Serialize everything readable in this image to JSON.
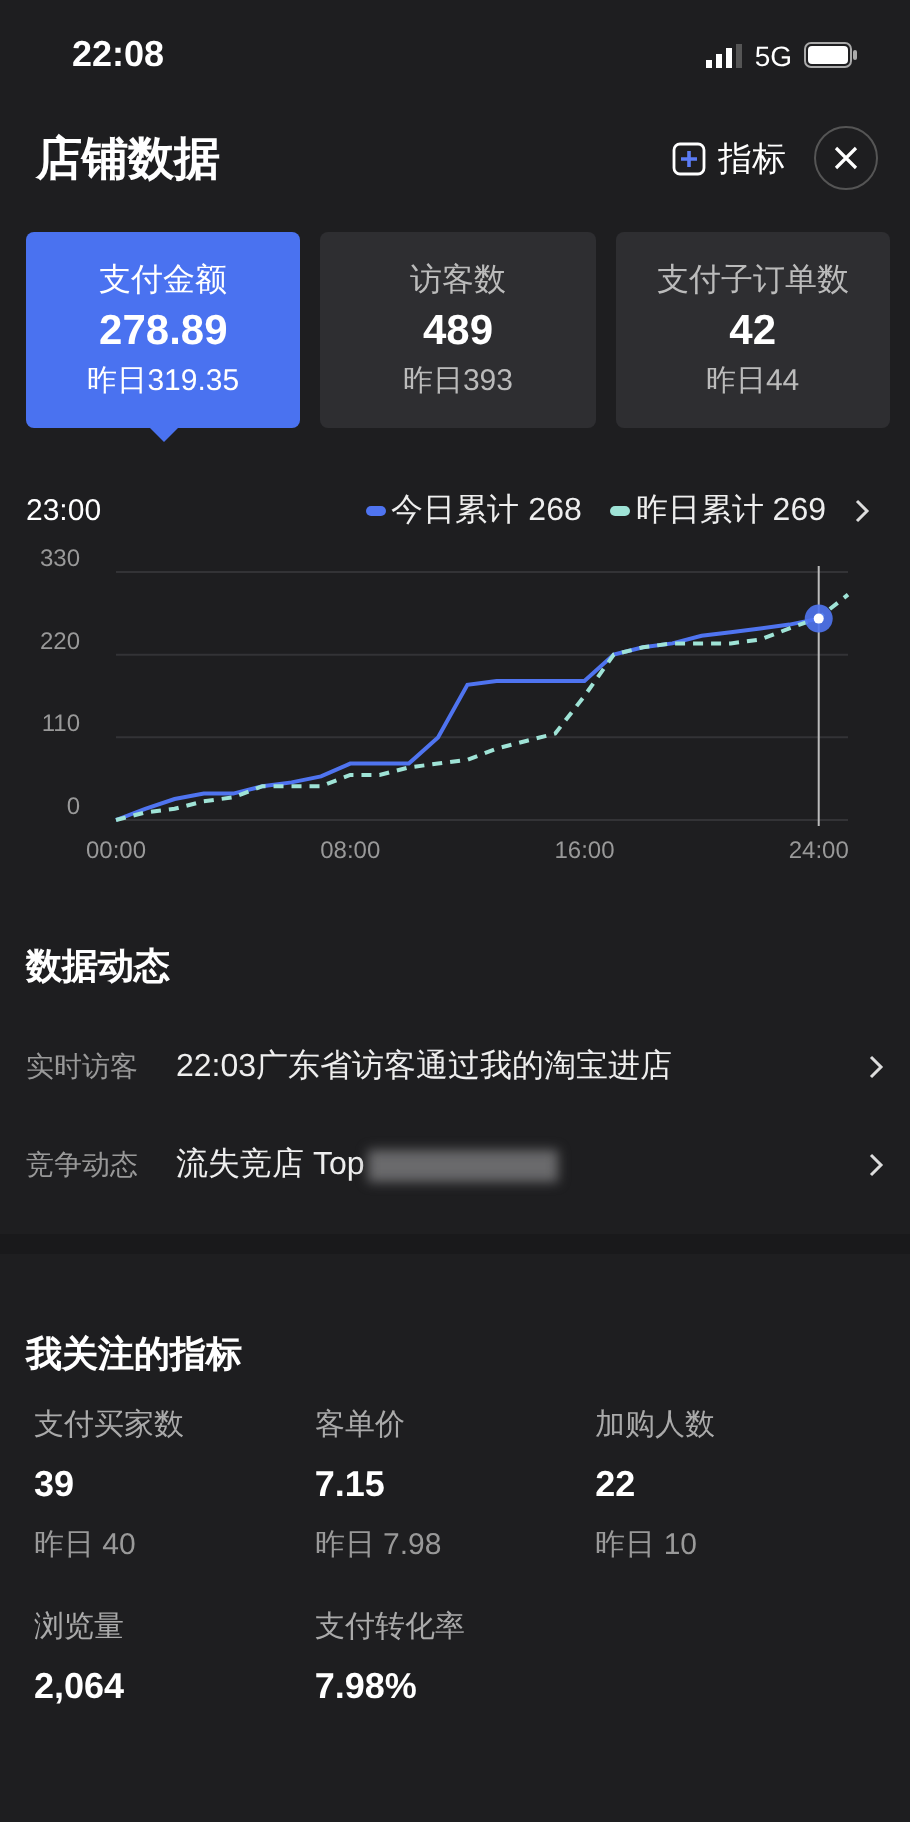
{
  "status_bar": {
    "time": "22:08",
    "network": "5G"
  },
  "header": {
    "title": "店铺数据",
    "add_label": "指标"
  },
  "cards": [
    {
      "label": "支付金额",
      "value": "278.89",
      "yesterday": "昨日319.35",
      "selected": true
    },
    {
      "label": "访客数",
      "value": "489",
      "yesterday": "昨日393",
      "selected": false
    },
    {
      "label": "支付子订单数",
      "value": "42",
      "yesterday": "昨日44",
      "selected": false
    }
  ],
  "trend": {
    "time": "23:00",
    "legend": [
      {
        "value": "268"
      },
      {
        "value": "269"
      }
    ],
    "chart_data": {
      "type": "line",
      "x": [
        0,
        1,
        2,
        3,
        4,
        5,
        6,
        7,
        8,
        9,
        10,
        11,
        12,
        13,
        14,
        15,
        16,
        17,
        18,
        19,
        20,
        21,
        22,
        23,
        24,
        25
      ],
      "xlim": [
        0,
        25
      ],
      "ylim": [
        0,
        330
      ],
      "xticks": [
        {
          "value": 0,
          "label": "00:00"
        },
        {
          "value": 8,
          "label": "08:00"
        },
        {
          "value": 16,
          "label": "16:00"
        },
        {
          "value": 24,
          "label": "24:00"
        }
      ],
      "yticks": [
        0,
        110,
        220,
        330
      ],
      "ref_lines": [
        {
          "axis": "x",
          "value": 24
        }
      ],
      "series": [
        {
          "name": "今日累计",
          "color": "#4f74f0",
          "line_style": "solid",
          "values": [
            0,
            15,
            28,
            35,
            35,
            45,
            50,
            58,
            75,
            75,
            75,
            110,
            180,
            185,
            185,
            185,
            185,
            220,
            230,
            235,
            245,
            250,
            255,
            260,
            268,
            null
          ]
        },
        {
          "name": "昨日累计",
          "color": "#9fe3d6",
          "line_style": "dashed",
          "values": [
            0,
            10,
            15,
            25,
            30,
            45,
            45,
            45,
            60,
            60,
            70,
            75,
            80,
            95,
            105,
            115,
            165,
            220,
            230,
            235,
            235,
            235,
            240,
            255,
            269,
            300
          ]
        }
      ]
    }
  },
  "dynamics": {
    "title": "数据动态",
    "rows": [
      {
        "label": "实时访客",
        "text": "22:03广东省访客通过我的淘宝进店",
        "redacted": false
      },
      {
        "label": "竞争动态",
        "text": "流失竞店 Top",
        "redacted": true
      }
    ]
  },
  "metrics": {
    "title": "我关注的指标",
    "items": [
      {
        "label": "支付买家数",
        "value": "39",
        "yesterday": "昨日 40"
      },
      {
        "label": "客单价",
        "value": "7.15",
        "yesterday": "昨日 7.98"
      },
      {
        "label": "加购人数",
        "value": "22",
        "yesterday": "昨日 10"
      },
      {
        "label": "浏览量",
        "value": "2,064"
      },
      {
        "label": "支付转化率",
        "value": "7.98%"
      }
    ]
  }
}
